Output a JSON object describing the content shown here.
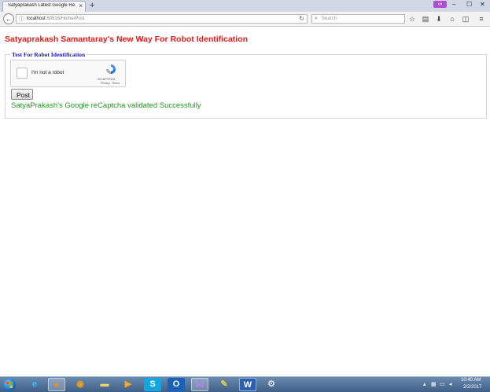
{
  "browser": {
    "tab": {
      "title": "Satyaprakash Latest Google Re...",
      "close": "×"
    },
    "new_tab": "+",
    "window": {
      "minimize": "–",
      "maximize": "☐",
      "close": "✕",
      "private": "∞"
    },
    "nav": {
      "back": "←",
      "url_host": "localhost",
      "url_path": ":60516/Home/Post",
      "reload": "↻",
      "search_placeholder": "Search"
    },
    "toolbar_icons": [
      "star-icon",
      "reading-list-icon",
      "download-icon",
      "home-icon",
      "pocket-icon",
      "menu-icon"
    ]
  },
  "page": {
    "heading": "Satyaprakash Samantaray's New Way For Robot Identification",
    "legend": "Test For Robot Identification",
    "recaptcha": {
      "label": "I'm not a robot",
      "brand": "reCAPTCHA",
      "links": "Privacy - Terms"
    },
    "post_button": "Post",
    "success_message": "SatyaPrakash's Google reCaptcha validated Successfully",
    "colors": {
      "heading": "#e21a1a",
      "legend": "#1616d0",
      "success": "#1c9a1c"
    }
  },
  "taskbar": {
    "apps": [
      "internet-explorer-icon",
      "firefox-icon",
      "chrome-icon",
      "file-explorer-icon",
      "media-player-icon",
      "skype-icon",
      "outlook-icon",
      "visual-studio-icon",
      "tools-icon",
      "word-icon",
      "settings-icon"
    ],
    "clock": {
      "time": "10:40 AM",
      "date": "2/2/2017"
    }
  }
}
